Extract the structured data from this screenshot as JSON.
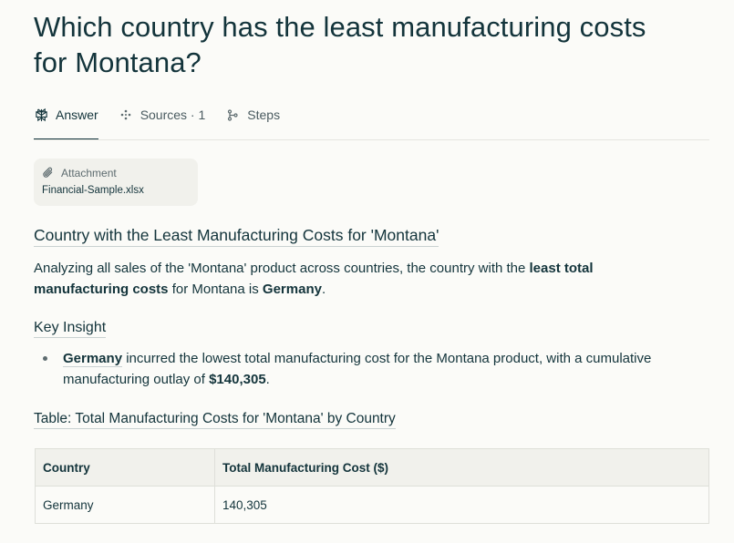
{
  "question": {
    "title": "Which country has the least manufacturing costs for Montana?"
  },
  "tabs": [
    {
      "label": "Answer",
      "icon": "perplexity-logo-icon",
      "active": true
    },
    {
      "label": "Sources · 1",
      "icon": "sources-icon",
      "active": false
    },
    {
      "label": "Steps",
      "icon": "steps-icon",
      "active": false
    }
  ],
  "attachment": {
    "header": "Attachment",
    "icon": "paperclip-icon",
    "filename": "Financial-Sample.xlsx"
  },
  "answer": {
    "heading": "Country with the Least Manufacturing Costs for 'Montana'",
    "intro_part1": "Analyzing all sales of the 'Montana' product across countries, the country with the ",
    "intro_bold1": "least total manufacturing costs",
    "intro_part2": " for Montana is ",
    "intro_bold2": "Germany",
    "intro_part3": ".",
    "key_insight_heading": "Key Insight",
    "bullet_country": "Germany",
    "bullet_text": " incurred the lowest total manufacturing cost for the Montana product, with a cumulative manufacturing outlay of ",
    "bullet_amount": "$140,305",
    "bullet_end": ".",
    "table_heading": "Table: Total Manufacturing Costs for 'Montana' by Country"
  },
  "table": {
    "headers": [
      "Country",
      "Total Manufacturing Cost ($)"
    ],
    "rows": [
      [
        "Germany",
        "140,305"
      ]
    ]
  }
}
